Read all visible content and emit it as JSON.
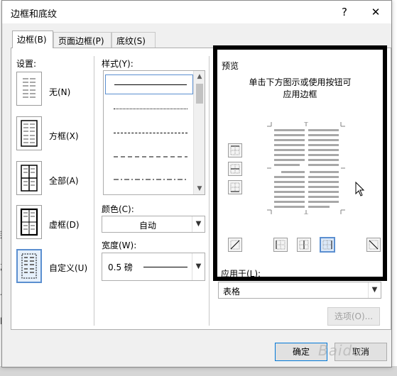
{
  "window": {
    "title": "边框和底纹",
    "help": "?",
    "close": "✕"
  },
  "tabs": [
    {
      "label": "边框(B)"
    },
    {
      "label": "页面边框(P)"
    },
    {
      "label": "底纹(S)"
    }
  ],
  "settings": {
    "heading": "设置:",
    "items": [
      {
        "label": "无(N)"
      },
      {
        "label": "方框(X)"
      },
      {
        "label": "全部(A)"
      },
      {
        "label": "虚框(D)"
      },
      {
        "label": "自定义(U)"
      }
    ],
    "selected": "自定义(U)"
  },
  "style": {
    "heading": "样式(Y):",
    "lines": [
      "solid",
      "dotted",
      "dashed-small",
      "dashed",
      "dash-dot"
    ]
  },
  "color": {
    "heading": "颜色(C):",
    "value": "自动"
  },
  "width": {
    "heading": "宽度(W):",
    "value": "0.5 磅"
  },
  "preview": {
    "heading": "预览",
    "hint_line1": "单击下方图示或使用按钮可",
    "hint_line2": "应用边框"
  },
  "apply_to": {
    "heading": "应用于(L):",
    "value": "表格"
  },
  "buttons": {
    "options": "选项(O)...",
    "ok": "确定",
    "cancel": "取消"
  },
  "background_chars": [
    "拜",
    "乙",
    "合",
    "l"
  ],
  "watermark": "Baidu"
}
